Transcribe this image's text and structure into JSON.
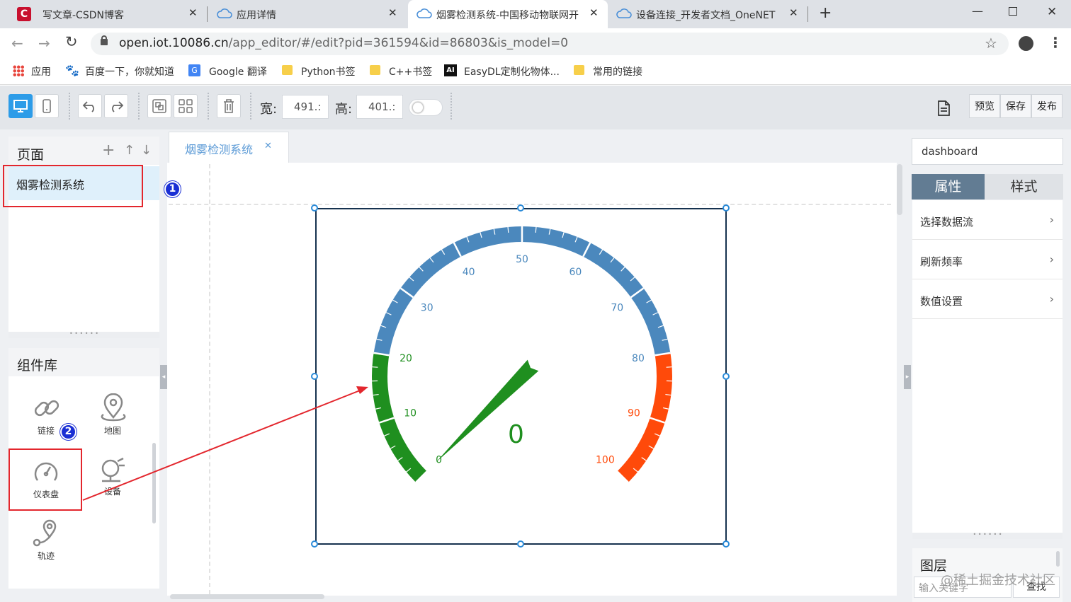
{
  "browser": {
    "tabs": [
      {
        "title": "写文章-CSDN博客",
        "icon": "csdn-logo-icon"
      },
      {
        "title": "应用详情",
        "icon": "cloud-icon"
      },
      {
        "title": "烟雾检测系统-中国移动物联网开",
        "icon": "cloud-icon"
      },
      {
        "title": "设备连接_开发者文档_OneNET",
        "icon": "cloud-icon"
      }
    ],
    "url_host": "open.iot.10086.cn",
    "url_path": "/app_editor/#/edit?pid=361594&id=86803&is_model=0",
    "bookmarks": [
      "应用",
      "百度一下，你就知道",
      "Google 翻译",
      "Python书签",
      "C++书签",
      "EasyDL定制化物体...",
      "常用的链接"
    ]
  },
  "toolbar": {
    "width_label": "宽:",
    "width_value": "491.:",
    "height_label": "高:",
    "height_value": "401.:",
    "preview": "预览",
    "save": "保存",
    "publish": "发布"
  },
  "left": {
    "pages_title": "页面",
    "page_item": "烟雾检测系统",
    "library_title": "组件库",
    "components": [
      "链接",
      "地图",
      "仪表盘",
      "设备",
      "轨迹"
    ]
  },
  "canvas": {
    "tab_label": "烟雾检测系统",
    "gauge": {
      "value": "0",
      "ticks": [
        "0",
        "10",
        "20",
        "30",
        "40",
        "50",
        "60",
        "70",
        "80",
        "90",
        "100"
      ],
      "min": 0,
      "max": 100,
      "current": 0,
      "colors": {
        "low": "#1f8f1f",
        "mid": "#4b88bd",
        "high": "#ff4a0a"
      }
    },
    "annotations": [
      "1",
      "2"
    ]
  },
  "right": {
    "search_value": "dashboard",
    "tab_props": "属性",
    "tab_style": "样式",
    "rows": [
      "选择数据流",
      "刷新频率",
      "数值设置"
    ],
    "layers_title": "图层",
    "layers_input": "输入关键字",
    "layers_search": "查找"
  },
  "watermark": "@稀土掘金技术社区"
}
